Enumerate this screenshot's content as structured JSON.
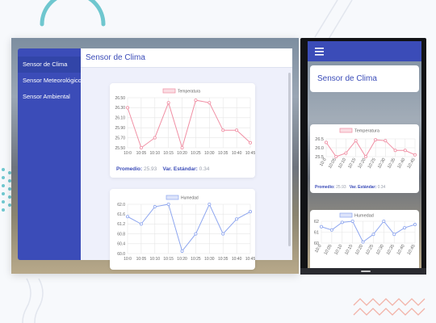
{
  "desktop": {
    "sidebar": [
      {
        "label": "Sensor de Clima",
        "active": true
      },
      {
        "label": "Sensor Meteorológico",
        "active": false
      },
      {
        "label": "Sensor Ambiental",
        "active": false
      }
    ],
    "header_title": "Sensor de Clima",
    "stats": {
      "promedio_label": "Promedio:",
      "promedio_value": "25.93",
      "std_label": "Var. Estándar:",
      "std_value": "0.34"
    }
  },
  "phone": {
    "menu_icon": "hamburger-icon",
    "title": "Sensor de Clima",
    "stats": {
      "promedio_label": "Promedio:",
      "promedio_value": "25.93",
      "std_label": "Var. Estándar:",
      "std_value": "0.34"
    }
  },
  "colors": {
    "accent": "#3b4cb8",
    "temperature": "#f08ea3",
    "humidity": "#8ea6ef"
  },
  "chart_data": [
    {
      "id": "desktop-temp",
      "type": "line",
      "x": [
        "10:0",
        "10:05",
        "10:10",
        "10:15",
        "10:20",
        "10:25",
        "10:30",
        "10:35",
        "10:40",
        "10:45"
      ],
      "series": [
        {
          "name": "Temperatura",
          "values": [
            26.3,
            25.5,
            25.7,
            26.4,
            25.5,
            26.45,
            26.4,
            25.85,
            25.85,
            25.6
          ]
        }
      ],
      "ylim": [
        25.5,
        26.5
      ],
      "yticks": [
        "26.50",
        "26.30",
        "26.10",
        "25.90",
        "25.70",
        "25.50"
      ],
      "legend": "top",
      "grid": true
    },
    {
      "id": "desktop-hum",
      "type": "line",
      "x": [
        "10:0",
        "10:05",
        "10:10",
        "10:15",
        "10:20",
        "10:25",
        "10:30",
        "10:35",
        "10:40",
        "10:45"
      ],
      "series": [
        {
          "name": "Humedad",
          "values": [
            61.5,
            61.2,
            61.9,
            62.0,
            60.1,
            60.8,
            62.0,
            60.8,
            61.4,
            61.7
          ]
        }
      ],
      "ylim": [
        60.0,
        62.0
      ],
      "yticks": [
        "62.0",
        "61.6",
        "61.2",
        "60.8",
        "60.4",
        "60.0"
      ],
      "legend": "top",
      "grid": true
    },
    {
      "id": "phone-temp",
      "type": "line",
      "x": [
        "10:0",
        "10:05",
        "10:10",
        "10:15",
        "10:20",
        "10:25",
        "10:30",
        "10:35",
        "10:40",
        "10:45"
      ],
      "series": [
        {
          "name": "Temperatura",
          "values": [
            26.3,
            25.5,
            25.7,
            26.4,
            25.5,
            26.45,
            26.4,
            25.85,
            25.85,
            25.6
          ]
        }
      ],
      "ylim": [
        25.5,
        26.5
      ],
      "yticks": [
        "26.5",
        "26.0",
        "25.5"
      ],
      "legend": "top",
      "grid": true
    },
    {
      "id": "phone-hum",
      "type": "line",
      "x": [
        "10:0",
        "10:05",
        "10:10",
        "10:15",
        "10:20",
        "10:25",
        "10:30",
        "10:35",
        "10:40",
        "10:45"
      ],
      "series": [
        {
          "name": "Humedad",
          "values": [
            61.5,
            61.2,
            61.9,
            62.0,
            60.1,
            60.8,
            62.0,
            60.8,
            61.4,
            61.7
          ]
        }
      ],
      "ylim": [
        60,
        62
      ],
      "yticks": [
        "62",
        "61",
        "60"
      ],
      "legend": "top",
      "grid": true
    }
  ]
}
